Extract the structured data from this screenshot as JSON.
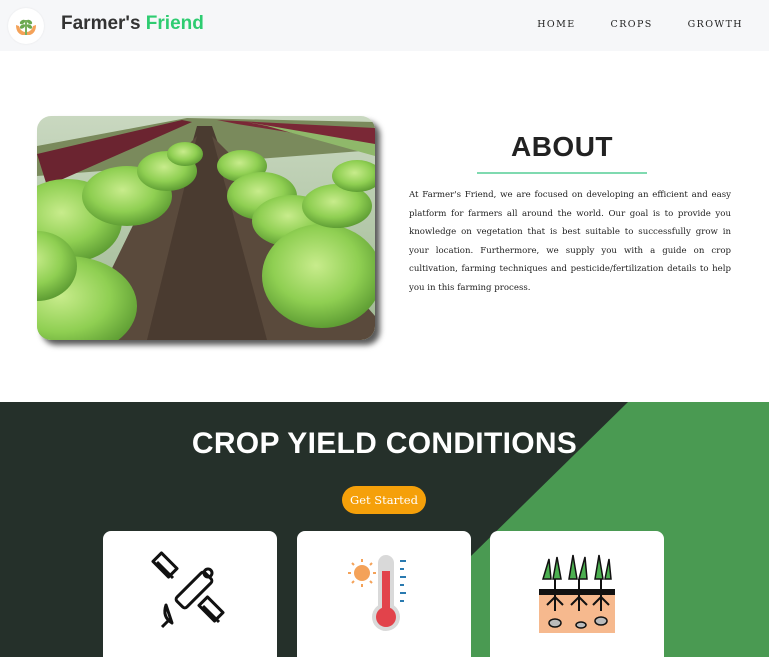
{
  "brand": {
    "name_part1": "Farmer's",
    "name_part2": "Friend"
  },
  "nav": {
    "home": "HOME",
    "crops": "CROPS",
    "growth": "GROWTH"
  },
  "about": {
    "title": "ABOUT",
    "text": "At Farmer's Friend, we are focused on developing an efficient and easy platform for farmers all around the world. Our goal is to provide you knowledge on vegetation that is best suitable to successfully grow in your location. Furthermore, we supply you with a guide on crop cultivation, farming techniques and pesticide/fertilization details to help you in this farming process."
  },
  "yield": {
    "title": "CROP YIELD CONDITIONS",
    "cta": "Get Started"
  },
  "colors": {
    "brand_green": "#2ecc71",
    "dark_green": "#25302a",
    "light_green": "#4a9a52",
    "cta_orange": "#f5a00a"
  },
  "icons": [
    "plant-in-hands-icon",
    "satellite-icon",
    "thermometer-icon",
    "soil-icon"
  ]
}
